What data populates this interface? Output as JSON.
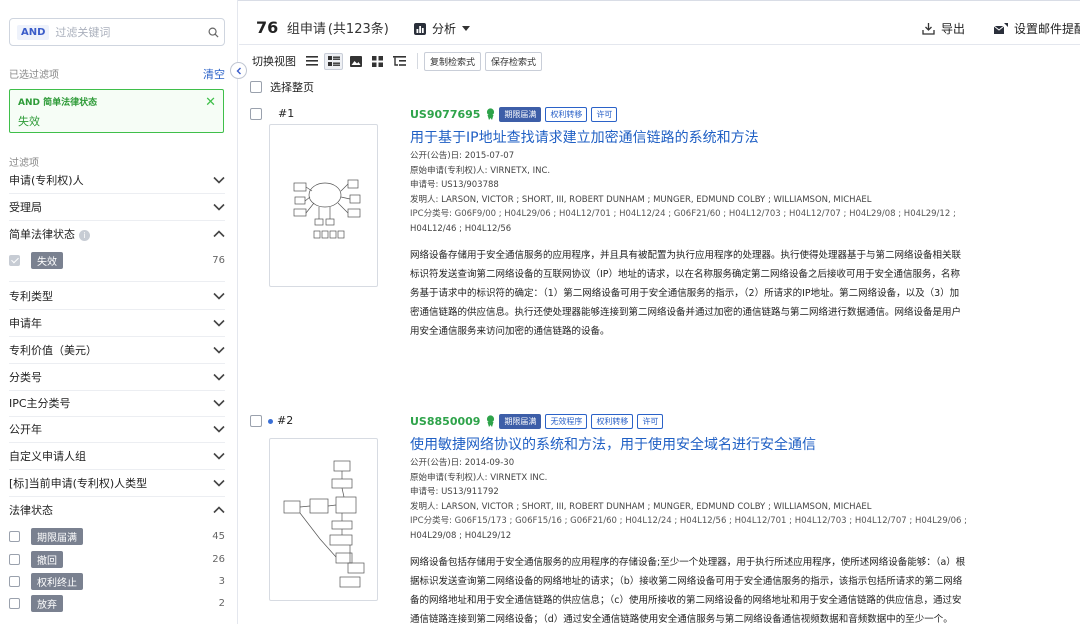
{
  "sidebar": {
    "search": {
      "chip": "AND",
      "placeholder": "过滤关键词"
    },
    "filtered_label": "已选过滤项",
    "clear_label": "清空",
    "active_filter": {
      "title": "AND 简单法律状态",
      "value": "失效"
    },
    "filter_items_label": "过滤项",
    "items_a": [
      {
        "label": "申请(专利权)人",
        "expanded": false
      },
      {
        "label": "受理局",
        "expanded": false
      },
      {
        "label": "简单法律状态",
        "expanded": true
      }
    ],
    "simple_status_option": {
      "label": "失效",
      "count": "76",
      "checked": true
    },
    "items_b": [
      {
        "label": "专利类型"
      },
      {
        "label": "申请年"
      },
      {
        "label": "专利价值（美元）"
      },
      {
        "label": "分类号"
      },
      {
        "label": "IPC主分类号"
      },
      {
        "label": "公开年"
      },
      {
        "label": "自定义申请人组"
      },
      {
        "label": "[标]当前申请(专利权)人类型"
      },
      {
        "label": "法律状态"
      }
    ],
    "legal_status_options": [
      {
        "label": "期限届满",
        "count": "45"
      },
      {
        "label": "撤回",
        "count": "26"
      },
      {
        "label": "权利终止",
        "count": "3"
      },
      {
        "label": "放弃",
        "count": "2"
      }
    ]
  },
  "header": {
    "count": "76",
    "count_suffix": "组申请",
    "total": "(共123条)",
    "analysis_label": "分析",
    "export_label": "导出",
    "mail_label": "设置邮件提醒"
  },
  "toolbar": {
    "view_label": "切换视图",
    "copy_label": "复制检索式",
    "save_label": "保存检索式"
  },
  "select_all_label": "选择整页",
  "results": [
    {
      "num": "#1",
      "pn": "US9077695",
      "badges": [
        "期限届满",
        "权利转移",
        "许可"
      ],
      "title": "用于基于IP地址查找请求建立加密通信链路的系统和方法",
      "pub_date": "公开(公告)日:  2015-07-07",
      "applicant": "原始申请(专利权)人:  VIRNETX, INC.",
      "app_no": "申请号:  US13/903788",
      "inventors": "发明人:  LARSON, VICTOR ;  SHORT, III, ROBERT DUNHAM ;  MUNGER, EDMUND COLBY ;  WILLIAMSON, MICHAEL",
      "ipc1": "IPC分类号:  G06F9/00 ;  H04L29/06 ;  H04L12/701 ;  H04L12/24 ;  G06F21/60 ;  H04L12/703 ;  H04L12/707 ;  H04L29/08 ;  H04L29/12 ;",
      "ipc2": "H04L12/46 ;  H04L12/56",
      "abstract": [
        "网络设备存储用于安全通信服务的应用程序，并且具有被配置为执行应用程序的处理器。执行使得处理器基于与第二网络设备相关联",
        "标识符发送查询第二网络设备的互联网协议（IP）地址的请求，以在名称服务确定第二网络设备之后接收可用于安全通信服务，名称",
        "务基于请求中的标识符的确定：（1）第二网络设备可用于安全通信服务的指示，（2）所请求的IP地址。第二网络设备，以及（3）加",
        "密通信链路的供应信息。执行还使处理器能够连接到第二网络设备并通过加密的通信链路与第二网络进行数据通信。网络设备是用户",
        "用安全通信服务来访问加密的通信链路的设备。"
      ]
    },
    {
      "num": "#2",
      "pn": "US8850009",
      "badges": [
        "期限届满",
        "无效程序",
        "权利转移",
        "许可"
      ],
      "title": "使用敏捷网络协议的系统和方法，用于使用安全域名进行安全通信",
      "pub_date": "公开(公告)日:  2014-09-30",
      "applicant": "原始申请(专利权)人:  VIRNETX INC.",
      "app_no": "申请号:  US13/911792",
      "inventors": "发明人:  LARSON, VICTOR ;  SHORT, III, ROBERT DUNHAM ;  MUNGER, EDMUND COLBY ;  WILLIAMSON, MICHAEL",
      "ipc1": "IPC分类号:  G06F15/173 ;  G06F15/16 ;  G06F21/60 ;  H04L12/24 ;  H04L12/56 ;  H04L12/701 ;  H04L12/703 ;  H04L12/707 ;  H04L29/06 ;",
      "ipc2": "H04L29/08 ;  H04L29/12",
      "abstract": [
        "网络设备包括存储用于安全通信服务的应用程序的存储设备;至少一个处理器，用于执行所述应用程序，使所述网络设备能够：（a）根",
        "据标识发送查询第二网络设备的网络地址的请求；（b）接收第二网络设备可用于安全通信服务的指示，该指示包括所请求的第二网络",
        "备的网络地址和用于安全通信链路的供应信息；（c）使用所接收的第二网络设备的网络地址和用于安全通信链路的供应信息，通过安",
        "通信链路连接到第二网络设备；（d）通过安全通信链路使用安全通信服务与第二网络设备通信视频数据和音频数据中的至少一个。"
      ]
    }
  ]
}
